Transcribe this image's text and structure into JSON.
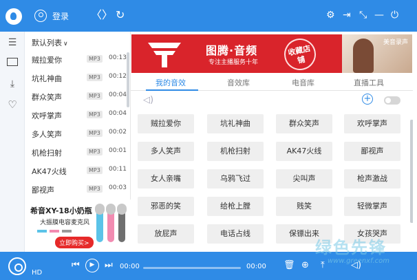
{
  "topbar": {
    "login_label": "登录",
    "back_glyph": "〈",
    "forward_glyph": "〉",
    "refresh_glyph": "↻",
    "settings_glyph": "⚙",
    "exit_glyph": "⇥",
    "mini_glyph": "⤡",
    "minimize_glyph": "—",
    "power_glyph": "⏻"
  },
  "sidebar_icons": {
    "list_glyph": "☰",
    "download_glyph": "⤓",
    "heart_glyph": "♡"
  },
  "playlist": {
    "header": "默认列表",
    "chevron": "∨",
    "items": [
      {
        "name": "贼拉爱你",
        "format": "MP3",
        "duration": "00:13"
      },
      {
        "name": "坑礼神曲",
        "format": "MP3",
        "duration": "00:12"
      },
      {
        "name": "群众笑声",
        "format": "MP3",
        "duration": "00:04"
      },
      {
        "name": "欢呼掌声",
        "format": "MP3",
        "duration": "00:04"
      },
      {
        "name": "多人笑声",
        "format": "MP3",
        "duration": "00:02"
      },
      {
        "name": "机枪扫射",
        "format": "MP3",
        "duration": "00:01"
      },
      {
        "name": "AK47火线",
        "format": "MP3",
        "duration": "00:11"
      },
      {
        "name": "鄙视声",
        "format": "MP3",
        "duration": "00:03"
      }
    ]
  },
  "ad_left": {
    "title": "希音XY-18小奶瓶",
    "subtitle": "大振膜电容麦克风",
    "button": "立即购买>"
  },
  "banner": {
    "title": "图腾·音频",
    "subtitle": "专注主播服务十年",
    "stamp": "收藏店铺",
    "photo_text": "美音录声"
  },
  "tabs": [
    {
      "label": "我的音效",
      "active": true
    },
    {
      "label": "音效库",
      "active": false
    },
    {
      "label": "电音库",
      "active": false
    },
    {
      "label": "直播工具",
      "active": false
    }
  ],
  "controls": {
    "speaker_glyph": "◁)",
    "add_glyph": "+"
  },
  "sound_buttons": [
    "贼拉爱你",
    "坑礼神曲",
    "群众笑声",
    "欢呼掌声",
    "多人笑声",
    "机枪扫射",
    "AK47火线",
    "鄙视声",
    "女人亲嘴",
    "乌鸦飞过",
    "尖叫声",
    "枪声激战",
    "邪恶的笑",
    "给枪上膛",
    "贱笑",
    "轻微掌声",
    "放屁声",
    "电话占线",
    "保镖出来",
    "女孩哭声"
  ],
  "player": {
    "hd_label": "HD",
    "prev_glyph": "⏮",
    "play_glyph": "▶",
    "next_glyph": "⏭",
    "time_current": "00:00",
    "time_total": "00:00",
    "progress": 0.0,
    "trash_glyph": "🗑",
    "record_glyph": "⊕",
    "upload_glyph": "⤒",
    "volume_glyph": "◁)"
  },
  "watermark": {
    "text": "绿色先锋",
    "url": "www.greenxf.com"
  },
  "colors": {
    "accent": "#2f8be6",
    "banner_red": "#d9242b",
    "buy_button": "#e62a2a"
  }
}
